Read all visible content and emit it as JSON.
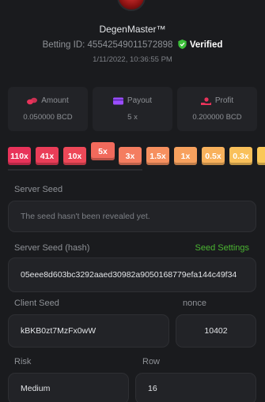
{
  "profile": {
    "username": "DegenMaster™",
    "betting_id_label": "Betting ID:",
    "betting_id": "45542549011572898",
    "verified_label": "Verified",
    "timestamp": "1/11/2022, 10:36:55 PM"
  },
  "stats": [
    {
      "label": "Amount",
      "value": "0.050000 BCD",
      "icon": "coins-icon",
      "color": "#e8335a"
    },
    {
      "label": "Payout",
      "value": "5 x",
      "icon": "card-icon",
      "color": "#9b4dff"
    },
    {
      "label": "Profit",
      "value": "0.200000 BCD",
      "icon": "hand-coin-icon",
      "color": "#e8335a"
    }
  ],
  "multipliers": [
    {
      "label": "110x",
      "color": "#e8335a"
    },
    {
      "label": "41x",
      "color": "#ea3d58"
    },
    {
      "label": "10x",
      "color": "#ee4858"
    },
    {
      "label": "5x",
      "color": "#f26a5c",
      "active": true
    },
    {
      "label": "3x",
      "color": "#f47d60"
    },
    {
      "label": "1.5x",
      "color": "#f6905f"
    },
    {
      "label": "1x",
      "color": "#f7a15e"
    },
    {
      "label": "0.5x",
      "color": "#f8b15c"
    },
    {
      "label": "0.3x",
      "color": "#f9c05a"
    },
    {
      "label": "",
      "color": "#fac858"
    }
  ],
  "server_seed": {
    "label": "Server Seed",
    "value": "The seed hasn't been revealed yet."
  },
  "server_seed_hash": {
    "label": "Server Seed (hash)",
    "settings_link": "Seed Settings",
    "value": "05eee8d603bc3292aaed30982a9050168779efa144c49f34"
  },
  "client_seed": {
    "label": "Client Seed",
    "value": "kBKB0zt7MzFx0wW"
  },
  "nonce": {
    "label": "nonce",
    "value": "10402"
  },
  "risk": {
    "label": "Risk",
    "value": "Medium"
  },
  "row": {
    "label": "Row",
    "value": "16"
  }
}
